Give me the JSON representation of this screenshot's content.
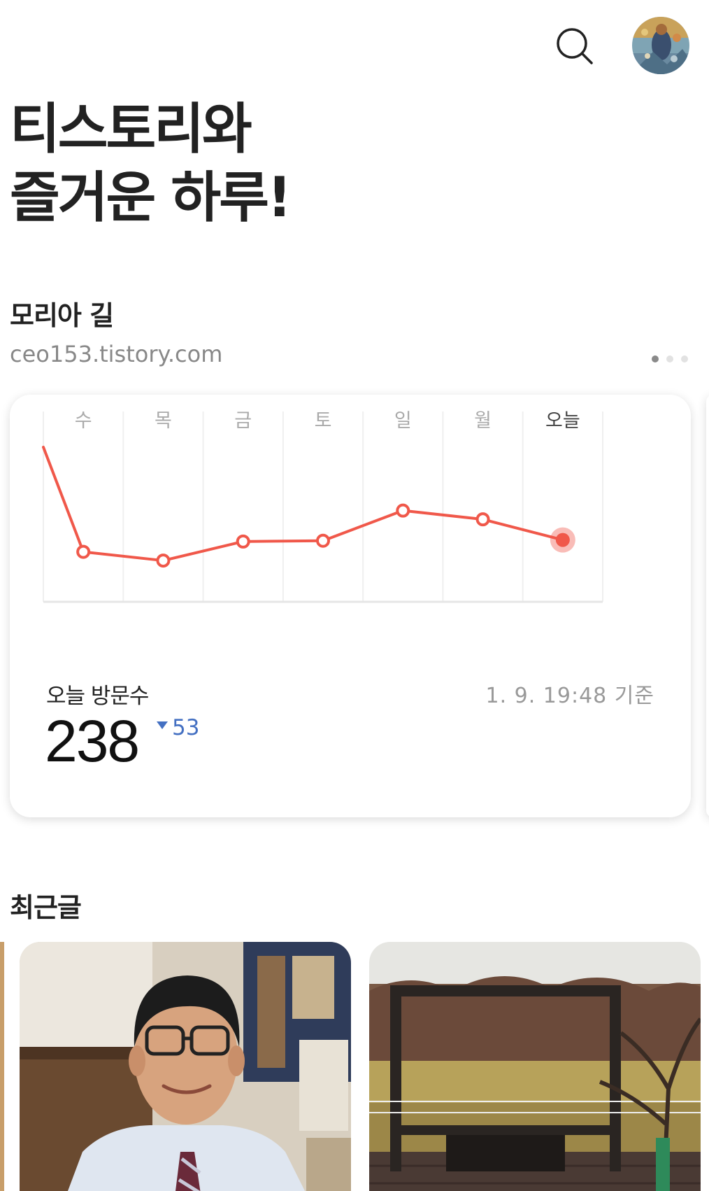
{
  "header": {
    "search_icon": "search-icon",
    "avatar_icon": "profile-avatar"
  },
  "headline": {
    "line1": "티스토리와",
    "line2": "즐거운 하루!"
  },
  "blog": {
    "name": "모리아 길",
    "url": "ceo153.tistory.com"
  },
  "pager": {
    "total": 3,
    "active": 1
  },
  "stats": {
    "today_label": "오늘 방문수",
    "updated": "1. 9. 19:48 기준",
    "today_count": "238",
    "delta": "53",
    "delta_direction": "down",
    "accent_color": "#f0584a",
    "delta_color": "#4470c2"
  },
  "chart_data": {
    "type": "line",
    "categories": [
      "수",
      "목",
      "금",
      "토",
      "일",
      "월",
      "오늘"
    ],
    "values": [
      223,
      212,
      236,
      237,
      275,
      264,
      238
    ],
    "previous_value": 355,
    "highlight_index": 6,
    "ylim": [
      160,
      400
    ],
    "grid": true
  },
  "recent": {
    "title": "최근글"
  }
}
